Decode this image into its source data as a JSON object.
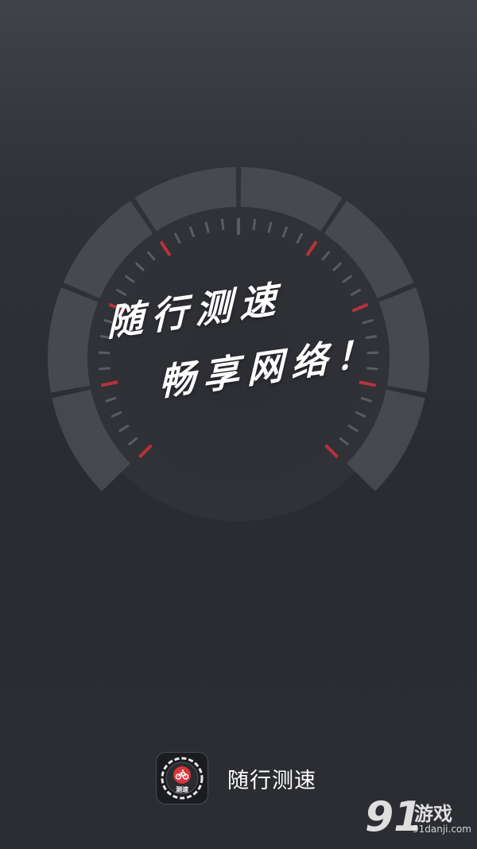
{
  "splash": {
    "slogan_line1": "随行测速",
    "slogan_line2": "畅享网络！"
  },
  "app": {
    "name": "随行测速",
    "icon_label": "测速"
  },
  "watermark": {
    "logo": "91",
    "name": "游戏",
    "url": "91danji.com"
  },
  "colors": {
    "accent": "#c8333a",
    "gauge_segment": "#4b4e55",
    "background": "#2b2d32",
    "text": "#ffffff"
  }
}
